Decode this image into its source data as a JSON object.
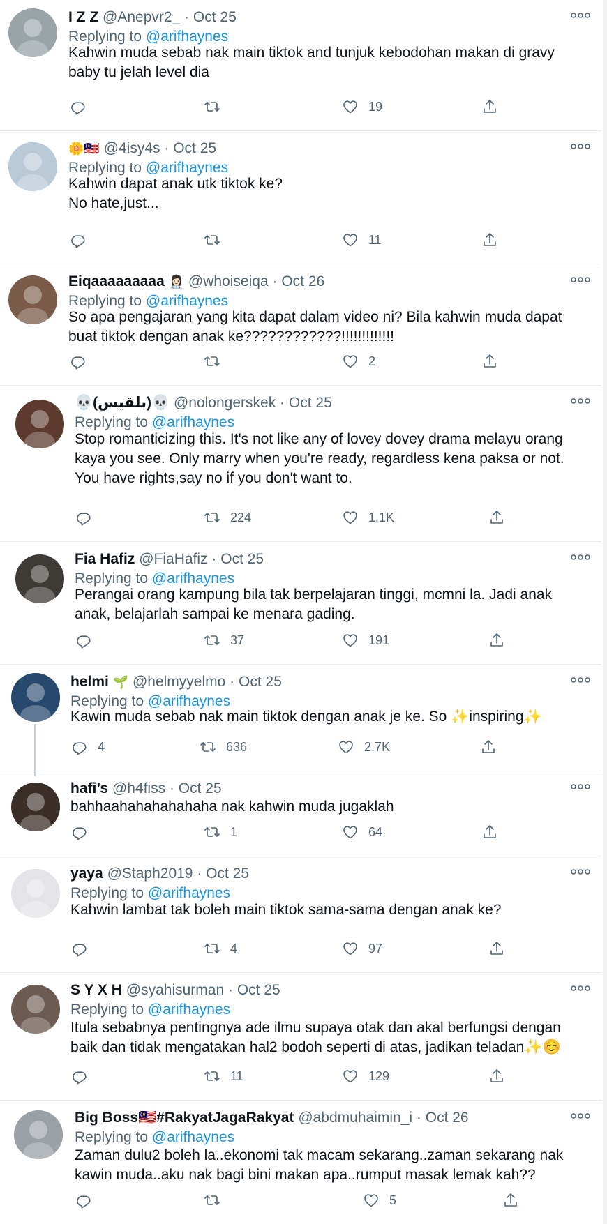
{
  "reply_prefix": "Replying to ",
  "tweets": [
    {
      "name": "I Z Z",
      "emoji": "",
      "handle": "@Anepvr2_",
      "dot": "·",
      "date": "Oct 25",
      "reply_to": "@arifhaynes",
      "lines": [
        "Kahwin muda sebab nak main tiktok and tunjuk kebodohan makan di gravy",
        "baby tu jelah level dia"
      ],
      "replies": "",
      "retweets": "",
      "likes": "19"
    },
    {
      "name": "",
      "emoji": "🌼🇲🇾",
      "handle": "@4isy4s",
      "dot": "·",
      "date": "Oct 25",
      "reply_to": "@arifhaynes",
      "lines": [
        "Kahwin dapat anak utk tiktok ke?",
        "No hate,just..."
      ],
      "replies": "",
      "retweets": "",
      "likes": "11"
    },
    {
      "name": "Eiqaaaaaaaaa",
      "emoji": "👩🏻‍⚕️",
      "handle": "@whoiseiqa",
      "dot": "·",
      "date": "Oct 26",
      "reply_to": "@arifhaynes",
      "lines": [
        "So apa pengajaran yang kita dapat dalam video ni? Bila kahwin muda dapat",
        "buat tiktok dengan anak ke????????????!!!!!!!!!!!!!"
      ],
      "replies": "",
      "retweets": "",
      "likes": "2"
    },
    {
      "name": "💀(بلقيس)💀",
      "emoji": "",
      "handle": "@nolongerskek",
      "dot": "·",
      "date": "Oct 25",
      "reply_to": "@arifhaynes",
      "lines": [
        "Stop romanticizing this. It's not like any of lovey dovey drama melayu orang",
        "kaya you see. Only marry when you're ready, regardless kena paksa or not.",
        "You have rights,say no if you don't want to."
      ],
      "replies": "",
      "retweets": "224",
      "likes": "1.1K"
    },
    {
      "name": "Fia Hafiz",
      "emoji": "",
      "handle": "@FiaHafiz",
      "dot": "·",
      "date": "Oct 25",
      "reply_to": "@arifhaynes",
      "lines": [
        "Perangai orang kampung bila tak berpelajaran tinggi, mcmni la. Jadi anak",
        "anak, belajarlah sampai ke menara gading."
      ],
      "replies": "",
      "retweets": "37",
      "likes": "191"
    },
    {
      "name": "helmi",
      "emoji": "🌱",
      "handle": "@helmyyelmo",
      "dot": "·",
      "date": "Oct 25",
      "reply_to": "@arifhaynes",
      "lines": [
        "Kawin muda sebab nak main tiktok dengan anak je ke. So ✨inspiring✨"
      ],
      "replies": "4",
      "retweets": "636",
      "likes": "2.7K"
    },
    {
      "name": "hafi’s",
      "emoji": "",
      "handle": "@h4fiss",
      "dot": "·",
      "date": "Oct 25",
      "reply_to": "",
      "lines": [
        "bahhaahahahahahaha nak kahwin muda jugaklah"
      ],
      "replies": "",
      "retweets": "1",
      "likes": "64"
    },
    {
      "name": "yaya",
      "emoji": "",
      "handle": "@Staph2019",
      "dot": "·",
      "date": "Oct 25",
      "reply_to": "@arifhaynes",
      "lines": [
        "Kahwin lambat tak boleh main tiktok sama-sama dengan anak ke?"
      ],
      "replies": "",
      "retweets": "4",
      "likes": "97"
    },
    {
      "name": "S Y X H",
      "emoji": "",
      "handle": "@syahisurman",
      "dot": "·",
      "date": "Oct 25",
      "reply_to": "@arifhaynes",
      "lines": [
        "Itula sebabnya pentingnya ade ilmu supaya otak dan akal berfungsi dengan",
        "baik dan tidak mengatakan hal2 bodoh seperti di atas, jadikan teladan✨☺️"
      ],
      "replies": "",
      "retweets": "11",
      "likes": "129"
    },
    {
      "name": "Big Boss🇲🇾#RakyatJagaRakyat",
      "emoji": "",
      "handle": "@abdmuhaimin_i",
      "dot": "·",
      "date": "Oct 26",
      "reply_to": "@arifhaynes",
      "lines": [
        "Zaman dulu2 boleh la..ekonomi tak macam sekarang..zaman sekarang nak",
        "kawin muda..aku nak bagi bini makan apa..rumput masak lemak kah??"
      ],
      "replies": "",
      "retweets": "",
      "likes": "5"
    }
  ],
  "icons": {
    "reply": "reply-icon",
    "retweet": "retweet-icon",
    "like": "heart-icon",
    "share": "share-icon",
    "more": "more-options-icon"
  },
  "colors": {
    "link": "#1b95e0",
    "muted": "#536471",
    "text": "#0f1419",
    "separator": "#e6ecf0"
  }
}
